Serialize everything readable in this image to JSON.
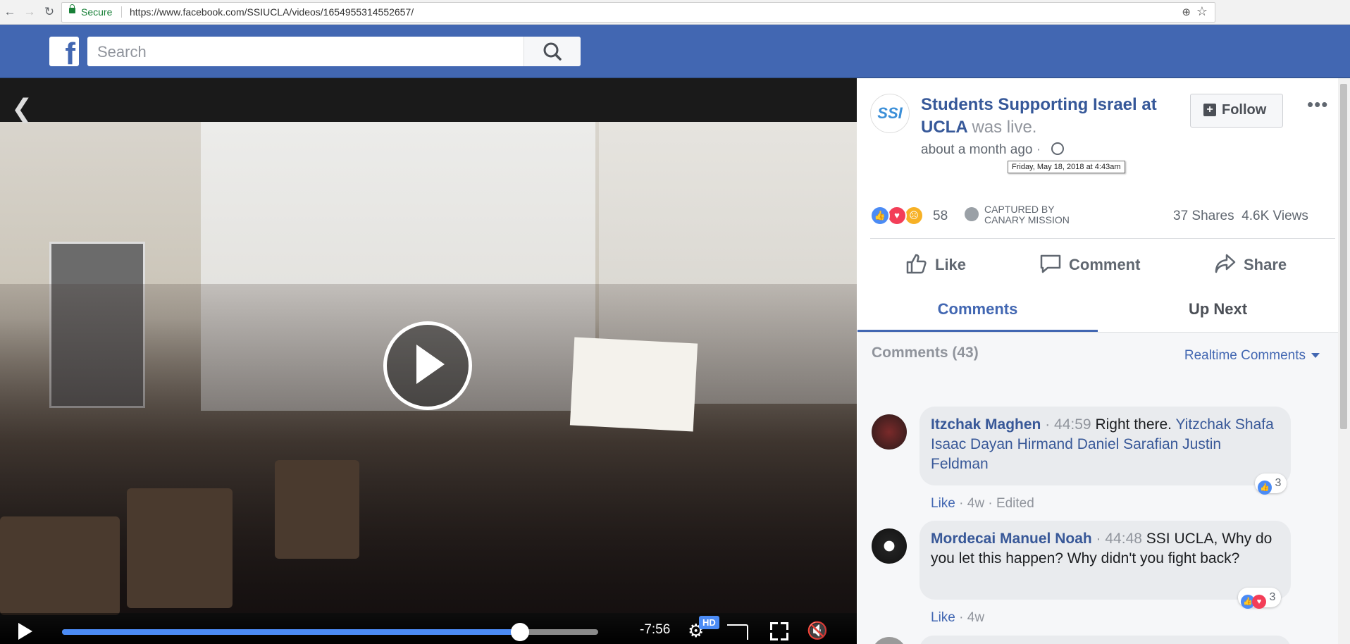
{
  "browser": {
    "secure_label": "Secure",
    "url": "https://www.facebook.com/SSIUCLA/videos/1654955314552657/"
  },
  "header": {
    "search_placeholder": "Search"
  },
  "video": {
    "time_remaining": "-7:56",
    "quality_badge": "HD",
    "progress_fraction": 0.854
  },
  "post": {
    "page_name": "Students Supporting Israel at UCLA",
    "was_live": "was live.",
    "time_ago": "about a month ago",
    "tooltip": "Friday, May 18, 2018 at 4:43am",
    "follow_label": "Follow",
    "more_label": "•••",
    "reaction_count": "58",
    "canary_line1": "CAPTURED BY",
    "canary_line2": "CANARY MISSION",
    "shares": "37 Shares",
    "views": "4.6K Views"
  },
  "actions": {
    "like": "Like",
    "comment": "Comment",
    "share": "Share"
  },
  "tabs": {
    "comments": "Comments",
    "up_next": "Up Next"
  },
  "comments_section": {
    "count_label": "Comments (43)",
    "sort_label": "Realtime Comments",
    "items": [
      {
        "author": "Itzchak Maghen",
        "timestamp": "44:59",
        "text": "Right there.",
        "tagged": "Yitzchak Shafa Isaac Dayan Hirmand Daniel Sarafian Justin Feldman",
        "reactions": "3",
        "like": "Like",
        "age": "4w",
        "edited": "Edited"
      },
      {
        "author": "Mordecai Manuel Noah",
        "timestamp": "44:48",
        "text": "SSI UCLA, Why do you let this happen? Why didn't you fight back?",
        "reactions": "3",
        "like": "Like",
        "age": "4w"
      }
    ]
  },
  "colors": {
    "facebook_blue": "#4267b2",
    "link_blue": "#385898",
    "progress_blue": "#4b8bf5"
  }
}
